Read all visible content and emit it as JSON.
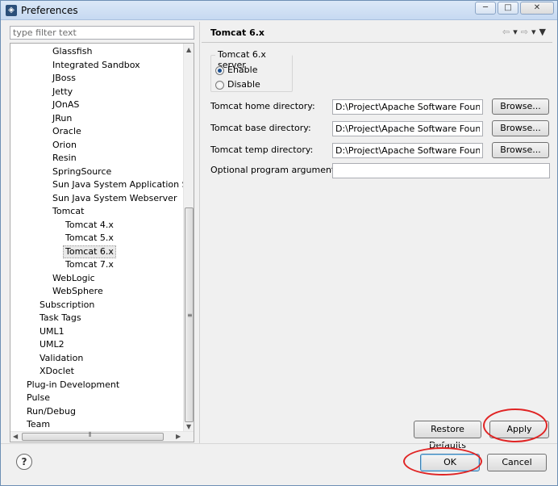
{
  "window": {
    "title": "Preferences",
    "app_icon": "eclipse-icon",
    "controls": {
      "minimize": "─",
      "maximize": "□",
      "close": "✕"
    }
  },
  "filter": {
    "placeholder": "type filter text",
    "value": ""
  },
  "tree": [
    {
      "label": "Glassfish",
      "level": 3
    },
    {
      "label": "Integrated Sandbox",
      "level": 3
    },
    {
      "label": "JBoss",
      "level": 3
    },
    {
      "label": "Jetty",
      "level": 3
    },
    {
      "label": "JOnAS",
      "level": 3
    },
    {
      "label": "JRun",
      "level": 3
    },
    {
      "label": "Oracle",
      "level": 3
    },
    {
      "label": "Orion",
      "level": 3
    },
    {
      "label": "Resin",
      "level": 3
    },
    {
      "label": "SpringSource",
      "level": 3
    },
    {
      "label": "Sun Java System Application Serve",
      "level": 3
    },
    {
      "label": "Sun Java System Webserver",
      "level": 3
    },
    {
      "label": "Tomcat",
      "level": 3
    },
    {
      "label": "Tomcat  4.x",
      "level": 4
    },
    {
      "label": "Tomcat  5.x",
      "level": 4
    },
    {
      "label": "Tomcat  6.x",
      "level": 4,
      "selected": true
    },
    {
      "label": "Tomcat  7.x",
      "level": 4
    },
    {
      "label": "WebLogic",
      "level": 3
    },
    {
      "label": "WebSphere",
      "level": 3
    },
    {
      "label": "Subscription",
      "level": 2
    },
    {
      "label": "Task Tags",
      "level": 2
    },
    {
      "label": "UML1",
      "level": 2
    },
    {
      "label": "UML2",
      "level": 2
    },
    {
      "label": "Validation",
      "level": 2
    },
    {
      "label": "XDoclet",
      "level": 2
    },
    {
      "label": "Plug-in Development",
      "level": 1
    },
    {
      "label": "Pulse",
      "level": 1
    },
    {
      "label": "Run/Debug",
      "level": 1
    },
    {
      "label": "Team",
      "level": 1
    }
  ],
  "page": {
    "title": "Tomcat  6.x",
    "group_title": "Tomcat  6.x server",
    "enable_label": "Enable",
    "disable_label": "Disable",
    "home_label": "Tomcat home directory:",
    "home_value": "D:\\Project\\Apache Software Foundatic",
    "base_label": "Tomcat base directory:",
    "base_value": "D:\\Project\\Apache Software Foundatic",
    "temp_label": "Tomcat temp directory:",
    "temp_value": "D:\\Project\\Apache Software Foundatic",
    "args_label": "Optional program arguments:",
    "args_value": "",
    "browse_label": "Browse...",
    "restore_label": "Restore Defaults",
    "apply_label": "Apply"
  },
  "footer": {
    "help": "?",
    "ok_label": "OK",
    "cancel_label": "Cancel"
  },
  "colors": {
    "annotation": "#e02424",
    "selection": "#e9e9e9",
    "radio_dot": "#1a4f91"
  }
}
